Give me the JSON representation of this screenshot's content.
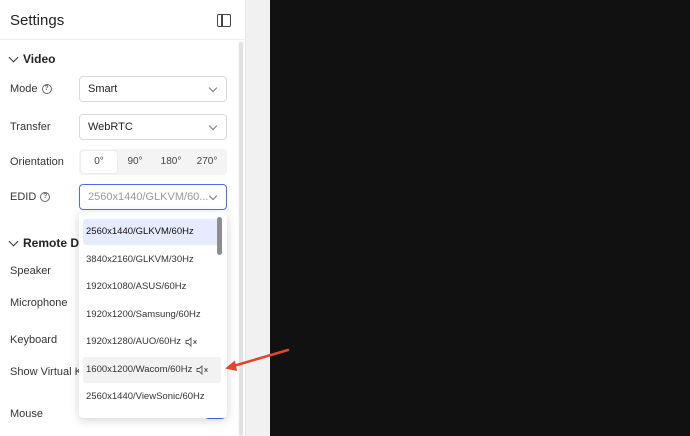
{
  "header": {
    "title": "Settings"
  },
  "video": {
    "section_title": "Video",
    "mode": {
      "label": "Mode",
      "value": "Smart"
    },
    "transfer": {
      "label": "Transfer",
      "value": "WebRTC"
    },
    "orientation": {
      "label": "Orientation",
      "options": [
        "0°",
        "90°",
        "180°",
        "270°"
      ],
      "selected": "0°"
    },
    "edid": {
      "label": "EDID",
      "value": "2560x1440/GLKVM/60..."
    }
  },
  "edid_options": [
    {
      "label": "2560x1440/GLKVM/60Hz",
      "muted": false,
      "state": "selected"
    },
    {
      "label": "3840x2160/GLKVM/30Hz",
      "muted": false,
      "state": ""
    },
    {
      "label": "1920x1080/ASUS/60Hz",
      "muted": false,
      "state": ""
    },
    {
      "label": "1920x1200/Samsung/60Hz",
      "muted": false,
      "state": ""
    },
    {
      "label": "1920x1280/AUO/60Hz",
      "muted": true,
      "state": ""
    },
    {
      "label": "1600x1200/Wacom/60Hz",
      "muted": true,
      "state": "hover"
    },
    {
      "label": "2560x1440/ViewSonic/60Hz",
      "muted": false,
      "state": ""
    }
  ],
  "remote": {
    "section_title": "Remote De",
    "speaker": "Speaker",
    "microphone": "Microphone",
    "keyboard": "Keyboard",
    "show_virtual": "Show Virtual K",
    "mouse": "Mouse",
    "mouse_enabled": true
  },
  "colors": {
    "accent": "#4f6bed",
    "arrow": "#e0462e",
    "selected_bg": "#e6ebff",
    "dark_area": "#111111"
  }
}
